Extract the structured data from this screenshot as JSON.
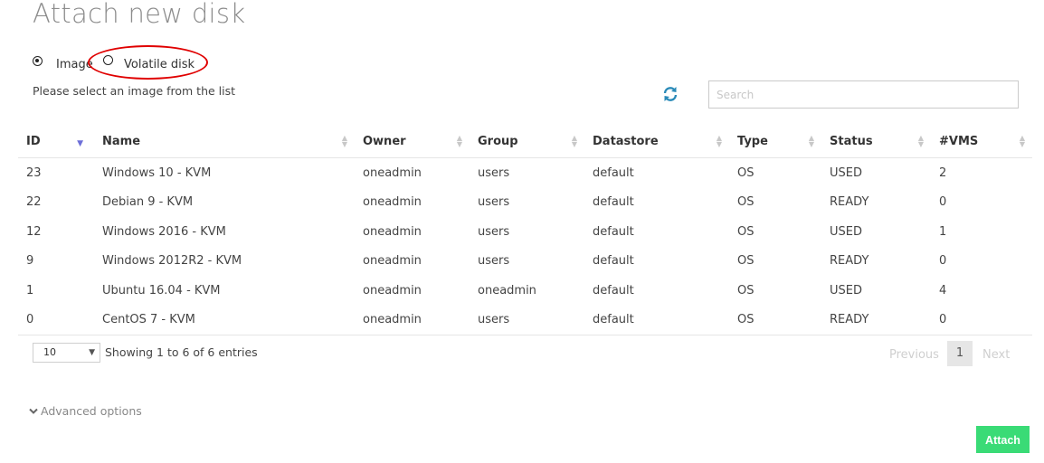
{
  "dialog": {
    "title": "Attach new disk"
  },
  "disk_type": {
    "selected": "Image",
    "options": [
      {
        "label": "Image",
        "checked": true
      },
      {
        "label": "Volatile disk",
        "checked": false
      }
    ]
  },
  "instructions": "Please select an image from the list",
  "search": {
    "placeholder": "Search",
    "value": ""
  },
  "icons": {
    "refresh": "refresh-icon",
    "sort": "sort-icon",
    "chevron": "chevron-down-icon"
  },
  "table": {
    "columns": [
      "ID",
      "Name",
      "Owner",
      "Group",
      "Datastore",
      "Type",
      "Status",
      "#VMS"
    ],
    "sorted_column": "ID",
    "rows": [
      [
        "23",
        "Windows 10 - KVM",
        "oneadmin",
        "users",
        "default",
        "OS",
        "USED",
        "2"
      ],
      [
        "22",
        "Debian 9 - KVM",
        "oneadmin",
        "users",
        "default",
        "OS",
        "READY",
        "0"
      ],
      [
        "12",
        "Windows 2016 - KVM",
        "oneadmin",
        "users",
        "default",
        "OS",
        "USED",
        "1"
      ],
      [
        "9",
        "Windows 2012R2 - KVM",
        "oneadmin",
        "users",
        "default",
        "OS",
        "READY",
        "0"
      ],
      [
        "1",
        "Ubuntu 16.04 - KVM",
        "oneadmin",
        "oneadmin",
        "default",
        "OS",
        "USED",
        "4"
      ],
      [
        "0",
        "CentOS 7 - KVM",
        "oneadmin",
        "users",
        "default",
        "OS",
        "READY",
        "0"
      ]
    ]
  },
  "pagination": {
    "page_length": "10",
    "info": "Showing 1 to 6 of 6 entries",
    "previous_label": "Previous",
    "current_page": "1",
    "next_label": "Next"
  },
  "advanced_options_label": "Advanced options",
  "attach_button_label": "Attach",
  "colors": {
    "accent_green": "#3adb76",
    "highlight_red": "#e00000",
    "sort_active": "#6d6fd8",
    "refresh_blue": "#2a8ab8"
  }
}
